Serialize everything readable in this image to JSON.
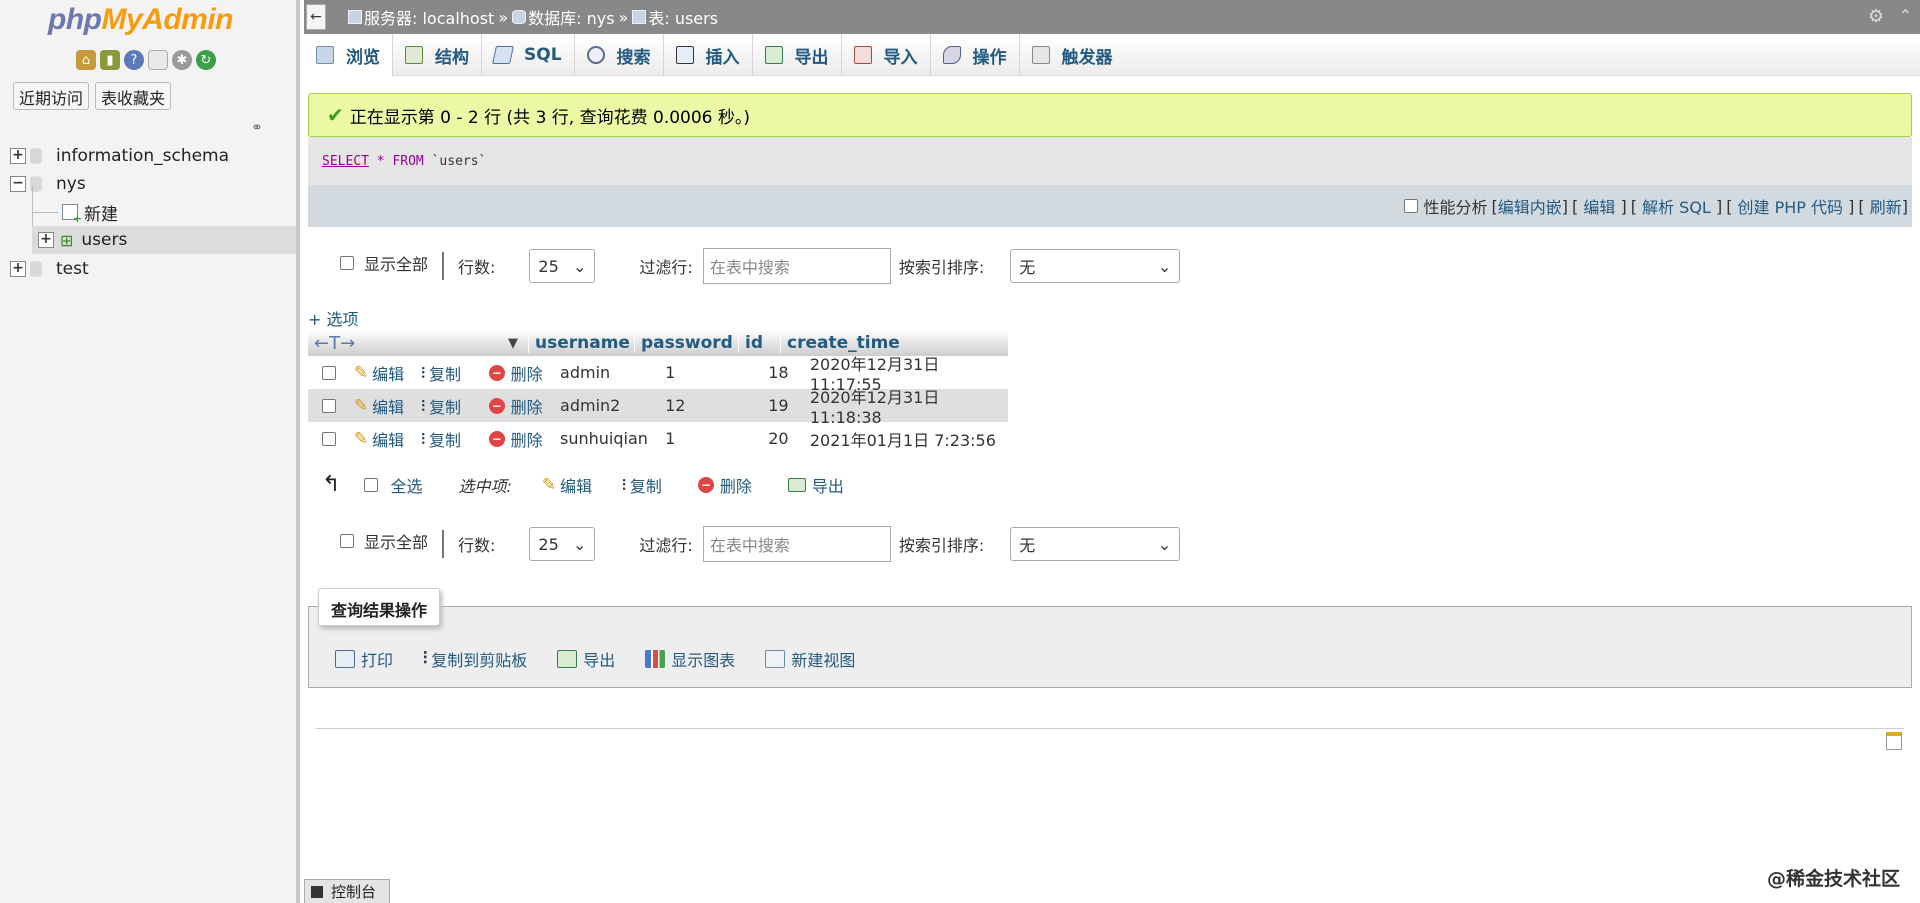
{
  "nav": {
    "logo_php": "php",
    "logo_myadmin": "MyAdmin",
    "tab_recent": "近期访问",
    "tab_favorites": "表收藏夹",
    "tree": {
      "db1": "information_schema",
      "db2": "nys",
      "new_item": "新建",
      "table1": "users",
      "db3": "test"
    }
  },
  "breadcrumb": {
    "server": "服务器: localhost",
    "database": "数据库: nys",
    "table": "表: users",
    "sep": "»"
  },
  "tabs": [
    "浏览",
    "结构",
    "SQL",
    "搜索",
    "插入",
    "导出",
    "导入",
    "操作",
    "触发器"
  ],
  "message": {
    "success": "正在显示第 0 - 2 行 (共 3 行, 查询花费 0.0006 秒。)"
  },
  "sql": {
    "select": "SELECT",
    "star": "*",
    "from": "FROM",
    "table": "`users`"
  },
  "sqlbar": {
    "profiling": "性能分析",
    "edit_inline": "编辑内嵌",
    "edit": "编辑",
    "explain": "解析 SQL",
    "create_php": "创建 PHP 代码",
    "refresh": "刷新",
    "lb": "[",
    "rb": "]"
  },
  "navrow": {
    "show_all": "显示全部",
    "rows_label": "行数:",
    "rows_value": "25",
    "filter_label": "过滤行:",
    "filter_placeholder": "在表中搜索",
    "sort_label": "按索引排序:",
    "sort_value": "无"
  },
  "options": "+ 选项",
  "table": {
    "arrows": "←T→",
    "columns": [
      "username",
      "password",
      "id",
      "create_time"
    ],
    "actions": {
      "edit": "编辑",
      "copy": "复制",
      "delete": "删除"
    },
    "rows": [
      {
        "username": "admin",
        "password": "1",
        "id": "18",
        "create_time": "2020年12月31日 11:17:55"
      },
      {
        "username": "admin2",
        "password": "12",
        "id": "19",
        "create_time": "2020年12月31日 11:18:38"
      },
      {
        "username": "sunhuiqian",
        "password": "1",
        "id": "20",
        "create_time": "2021年01月1日 7:23:56"
      }
    ]
  },
  "with_selected": {
    "check_all": "全选",
    "label": "选中项:",
    "edit": "编辑",
    "copy": "复制",
    "delete": "删除",
    "export": "导出"
  },
  "query_ops": {
    "legend": "查询结果操作",
    "print": "打印",
    "copy_clipboard": "复制到剪贴板",
    "export": "导出",
    "chart": "显示图表",
    "create_view": "新建视图"
  },
  "console": "控制台",
  "watermark": "@稀金技术社区",
  "colors": {
    "link": "#235a81",
    "success_bg": "#ebf8a4",
    "breadcrumb_bg": "#888888"
  }
}
